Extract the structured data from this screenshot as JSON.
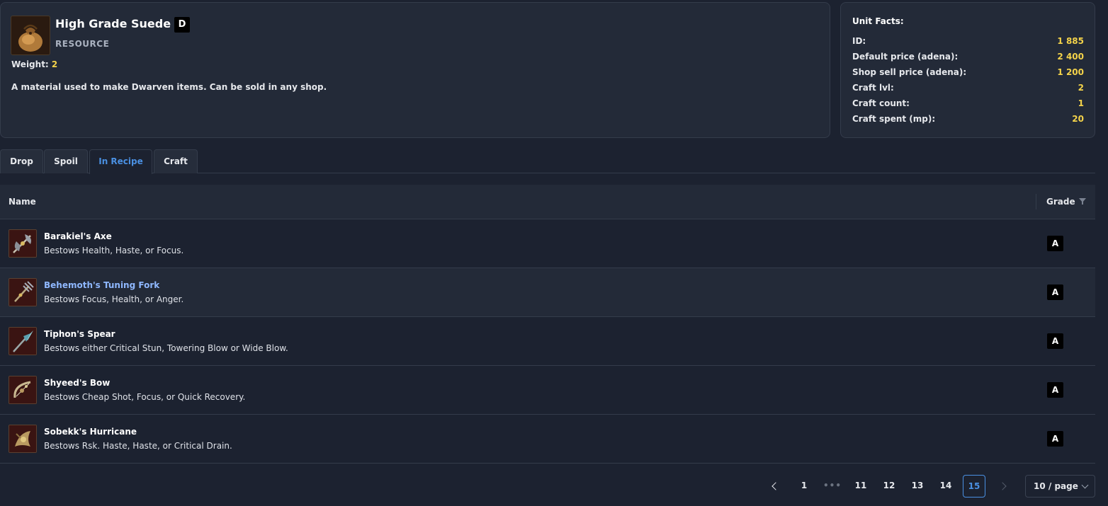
{
  "item": {
    "name": "High Grade Suede",
    "grade": "D",
    "type": "RESOURCE",
    "weight_label": "Weight:",
    "weight_value": "2",
    "description": "A material used to make Dwarven items. Can be sold in any shop.",
    "icon": "suede-bag-icon"
  },
  "facts": {
    "title": "Unit Facts:",
    "rows": [
      {
        "label": "ID:",
        "value": "1 885"
      },
      {
        "label": "Default price (adena):",
        "value": "2 400"
      },
      {
        "label": "Shop sell price (adena):",
        "value": "1 200"
      },
      {
        "label": "Craft lvl:",
        "value": "2"
      },
      {
        "label": "Craft count:",
        "value": "1"
      },
      {
        "label": "Craft spent (mp):",
        "value": "20"
      }
    ]
  },
  "tabs": [
    {
      "label": "Drop",
      "active": false
    },
    {
      "label": "Spoil",
      "active": false
    },
    {
      "label": "In Recipe",
      "active": true
    },
    {
      "label": "Craft",
      "active": false
    }
  ],
  "table": {
    "headers": {
      "name": "Name",
      "grade": "Grade"
    },
    "rows": [
      {
        "name": "Barakiel's Axe",
        "desc": "Bestows Health, Haste, or Focus.",
        "grade": "A",
        "icon": "axe-icon"
      },
      {
        "name": "Behemoth's Tuning Fork",
        "desc": "Bestows Focus, Health, or Anger.",
        "grade": "A",
        "icon": "fork-icon"
      },
      {
        "name": "Tiphon's Spear",
        "desc": "Bestows either Critical Stun, Towering Blow or Wide Blow.",
        "grade": "A",
        "icon": "spear-icon"
      },
      {
        "name": "Shyeed's Bow",
        "desc": "Bestows Cheap Shot, Focus, or Quick Recovery.",
        "grade": "A",
        "icon": "bow-icon"
      },
      {
        "name": "Sobekk's Hurricane",
        "desc": "Bestows Rsk. Haste, Haste, or Critical Drain.",
        "grade": "A",
        "icon": "hurricane-icon"
      }
    ]
  },
  "pagination": {
    "pages": [
      "1",
      "11",
      "12",
      "13",
      "14",
      "15"
    ],
    "ellipsis": "•••",
    "current": "15",
    "page_size": "10 / page"
  },
  "colors": {
    "accent": "#4a90e2",
    "value_yellow": "#f4d34a",
    "background": "#1c2230",
    "card": "#232a38"
  }
}
